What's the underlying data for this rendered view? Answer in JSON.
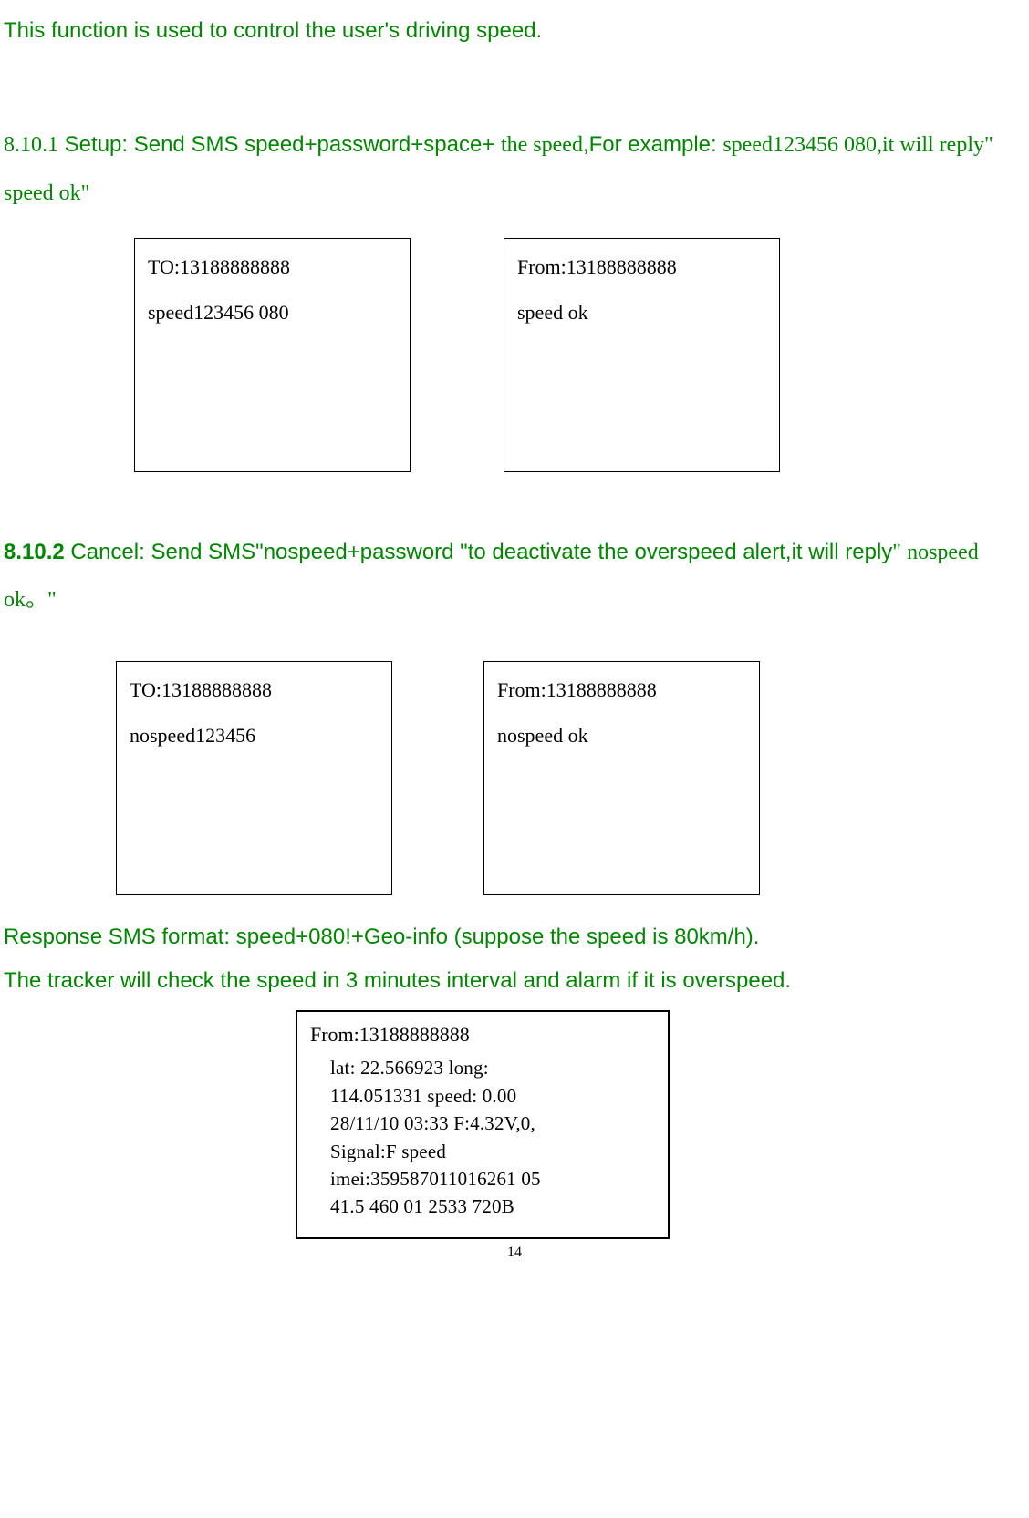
{
  "intro": "This function is used to control the user's driving speed.",
  "section_8101": {
    "number": "8.10.1",
    "setup_label": " Setup: Send SMS speed+password+space+ ",
    "the_speed": "the speed",
    "comma": ",",
    "for_example": "For example: ",
    "example_code": "speed123456 080,",
    "reply_text": "it will reply\" speed ok\""
  },
  "sms_boxes_1": {
    "left": {
      "line1": "TO:13188888888",
      "line2": "speed123456 080"
    },
    "right": {
      "line1": "From:13188888888",
      "line2": "speed ok"
    }
  },
  "section_8102": {
    "number": "8.10.2",
    "cancel_text": " Cancel: Send SMS\"nospeed+password \"to deactivate the overspeed alert,it will reply",
    "reply_quote": "\" nospeed ok。\""
  },
  "sms_boxes_2": {
    "left": {
      "line1": "TO:13188888888",
      "line2": "nospeed123456"
    },
    "right": {
      "line1": "From:13188888888",
      "line2": "nospeed ok"
    }
  },
  "response_line": "Response SMS format: speed+080!+Geo-info (suppose the speed is 80km/h).",
  "check_line": "The tracker will check the speed in 3 minutes interval and alarm if it is overspeed.",
  "response_box": {
    "from_line": "From:13188888888",
    "geo_l1": "lat: 22.566923 long:",
    "geo_l2": "114.051331 speed: 0.00",
    "geo_l3": "28/11/10 03:33 F:4.32V,0,",
    "geo_l4a": "Signal:F ",
    "geo_l4b": "speed",
    "geo_l5": "imei:359587011016261 05",
    "geo_l6": "41.5 460 01 2533 720B"
  },
  "page_number": "14"
}
